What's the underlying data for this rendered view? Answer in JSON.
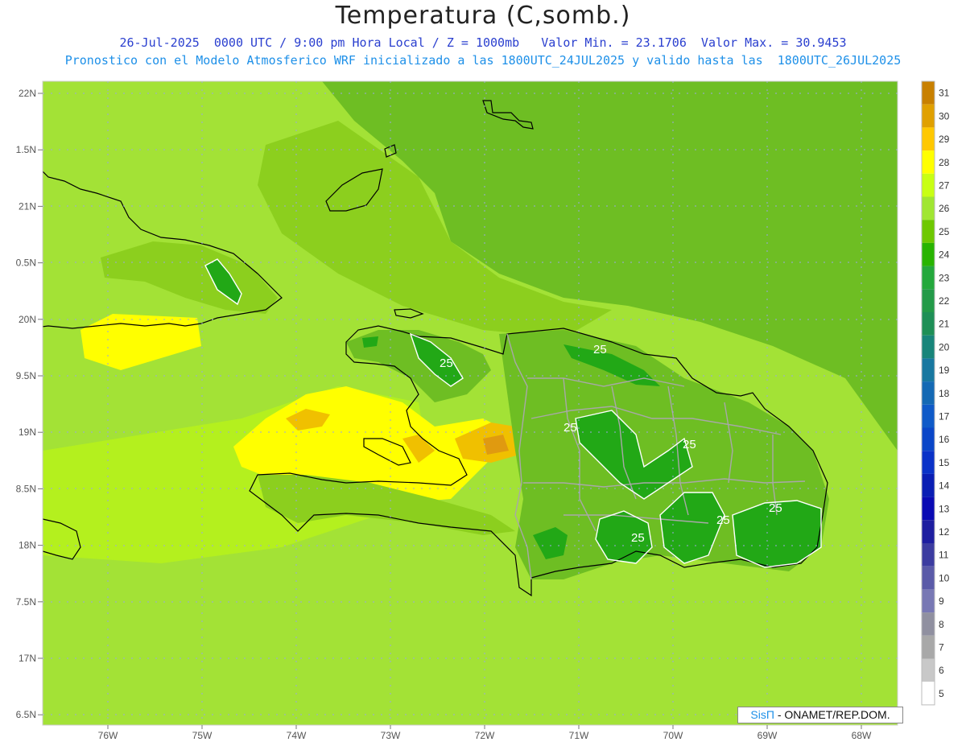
{
  "title": "Temperatura (C,somb.)",
  "subtitle_line1": "26-Jul-2025  0000 UTC / 9:00 pm Hora Local / Z = 1000mb   Valor Min. = 23.1706  Valor Max. = 30.9453",
  "subtitle_line2": "Pronostico con el Modelo Atmosferico WRF inicializado a las 1800UTC_24JUL2025 y valido hasta las  1800UTC_26JUL2025",
  "credit": {
    "brand": "SisΠ",
    "text": " - ONAMET/REP.DOM."
  },
  "lat_labels": [
    "22N",
    "1.5N",
    "21N",
    "0.5N",
    "20N",
    "9.5N",
    "19N",
    "8.5N",
    "18N",
    "7.5N",
    "17N",
    "6.5N"
  ],
  "lon_labels": [
    "76W",
    "75W",
    "74W",
    "73W",
    "72W",
    "71W",
    "70W",
    "69W",
    "68W"
  ],
  "contour_labels": [
    "25",
    "25",
    "25",
    "25",
    "25",
    "25",
    "25",
    "25"
  ],
  "colorbar": {
    "levels": [
      "31",
      "30",
      "29",
      "28",
      "27",
      "26",
      "25",
      "24",
      "23",
      "22",
      "21",
      "20",
      "19",
      "18",
      "17",
      "16",
      "15",
      "14",
      "13",
      "12",
      "11",
      "10",
      "9",
      "8",
      "7",
      "6",
      "5"
    ],
    "colors": [
      "#c88000",
      "#e0a000",
      "#ffc800",
      "#ffff00",
      "#c8ff14",
      "#a0e632",
      "#6ec800",
      "#28b400",
      "#24a83c",
      "#239a48",
      "#1e8f56",
      "#18857a",
      "#1878a0",
      "#1469b4",
      "#0f5ac8",
      "#0a46c8",
      "#0a32c8",
      "#0a1eb4",
      "#0a0ab4",
      "#1e1ea0",
      "#3c3ca0",
      "#5a5aa8",
      "#7878b4",
      "#9090a0",
      "#a8a8a8",
      "#c8c8c8",
      "#ffffff"
    ]
  },
  "map_colors": {
    "background": "#a3e236",
    "dark_green": "#6ebe23",
    "mid_green": "#8ccf1e",
    "lime": "#b4f01e",
    "yellow": "#ffff00",
    "orange": "#f0c000",
    "deep_orange": "#e09a10",
    "green24": "#22a816"
  }
}
